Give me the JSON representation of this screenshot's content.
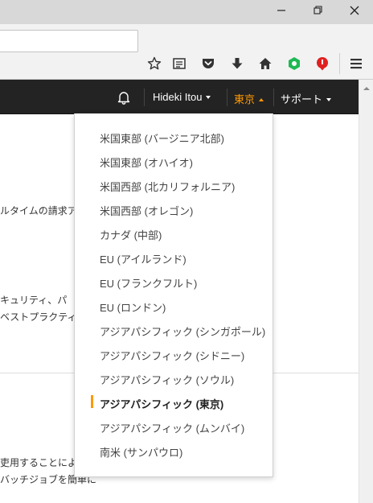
{
  "browser": {
    "window_controls": [
      "minimize",
      "restore",
      "close"
    ],
    "toolbar_icons": [
      "star-icon",
      "reader-icon",
      "pocket-icon",
      "download-icon",
      "home-icon",
      "extension-green-icon",
      "extension-red-icon",
      "menu-icon"
    ]
  },
  "nav": {
    "user": "Hideki Itou",
    "region": "東京",
    "support": "サポート",
    "region_color": "#ff9900"
  },
  "page": {
    "fragments": [
      "ルタイムの請求ア",
      "キュリティ、パ",
      "ベストプラクティス",
      "吏用することにより",
      "バッチジョブを簡単に"
    ]
  },
  "regions": [
    {
      "label": "米国東部 (バージニア北部)"
    },
    {
      "label": "米国東部 (オハイオ)"
    },
    {
      "label": "米国西部 (北カリフォルニア)"
    },
    {
      "label": "米国西部 (オレゴン)"
    },
    {
      "label": "カナダ (中部)"
    },
    {
      "label": "EU (アイルランド)"
    },
    {
      "label": "EU (フランクフルト)"
    },
    {
      "label": "EU (ロンドン)"
    },
    {
      "label": "アジアパシフィック (シンガポール)"
    },
    {
      "label": "アジアパシフィック (シドニー)"
    },
    {
      "label": "アジアパシフィック (ソウル)"
    },
    {
      "label": "アジアパシフィック (東京)",
      "selected": true
    },
    {
      "label": "アジアパシフィック (ムンバイ)"
    },
    {
      "label": "南米 (サンパウロ)"
    }
  ]
}
